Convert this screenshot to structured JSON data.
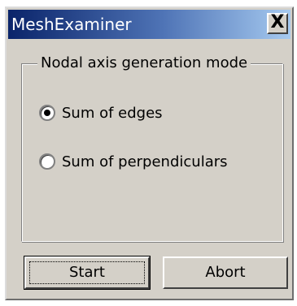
{
  "window": {
    "title": "MeshExaminer",
    "close_label": "X"
  },
  "group": {
    "label": "Nodal axis generation mode",
    "options": [
      {
        "label": "Sum of edges",
        "selected": true
      },
      {
        "label": "Sum of perpendiculars",
        "selected": false
      }
    ]
  },
  "buttons": {
    "start_label": "Start",
    "abort_label": "Abort"
  },
  "colors": {
    "titlebar_start": "#0a246a",
    "titlebar_end": "#a6caf0",
    "dialog_bg": "#d4d0c8"
  }
}
